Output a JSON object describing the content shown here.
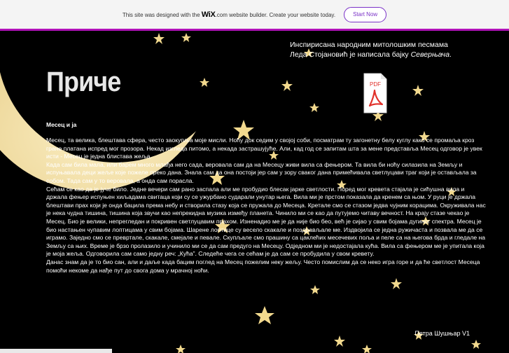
{
  "wix_banner": {
    "text_before": "This site was designed with the",
    "logo": "WiX",
    "text_after": ".com website builder. Create your website today.",
    "button_label": "Start Now"
  },
  "page": {
    "title": "Приче",
    "intro_line1": "Инспирисана народним митолошким песмама",
    "intro_line2_plain": "Леда Стојановић је написала бајку ",
    "intro_line2_italic": "Северњача",
    "intro_line2_end": ".",
    "pdf_label": "PDF",
    "story_title": "Месец и ја",
    "paragraphs": [
      "Месец, та велика, блештава сфера, често заокупља моје мисли. Ноћу док седим у својој соби, посматрам ту загонетну белу куглу како се промаља кроз гране платана испред мог прозора. Некад изгледа питомо, а некада застрашујуће. Али, кад год се запитам шта за мене представља Месец одговор је увек исти - Месец је једна блистава жеља.",
      "Када сам била мала, или барем много млађа него сада, веровала сам да на Месецу живи вила са фењером. Та вила би ноћу силазила на Земљу и испуњавала деци жеље које пожеле преко дана. Знала сам да она постоји јер сам у зору сваког дана примећивала светлуцави траг који је остављала за собом. Тада сам у то веровала, а онда сам порасла.",
      "Сећам се као да је јуче било. Једне вечери сам рано заспала али ме пробудио блесак јарке светлости. Поред мог кревета стајала је сићушна вила и држала фењер испуњен хиљадама свитаца који су се ужурбано сударали унутар њега. Вила ми је прстом показала да кренем са њом. У руци је држала блештави прах који је онда бацила према небу и створила стазу која се пружала до Месеца. Кретале смо се стазом једва чујним корацима. Окруживала нас је нека чудна тишина, тишина која звучи као непрекидна музика између планета. Чинило ми се као да путујемо читаву вечност. На крају стазе чекао је Месец. Био је велики, непрегледан и покривен светлуцавим прахом. Изненадио ме је да није био бео, већ је сијао у свим бојама дугиног спектра. Месец је био настањен чупавим лоптицама у свим бојама. Шарене лоптице су весело скакале и поздрављале ме. Издвојила се једна ружичаста и позвала ме да се играмо. Заједно смо се превртале, скакале, смејале и певале. Скупљале смо прашину са цаклећих месечевих поља и пеле са на његова брда и гледале на Земљу са њих. Време је брзо пролазило и учинило ми се да сам предуго на Месецу. Одједном ми је недостајала кућа. Вила са фењером ме је упитала која је моја жеља. Одговорила сам само једну реч: „Кућа”. Следеће чега се сећам је да сам се пробудила у свом кревету.",
      "Данас знам да је то био сан, али и даље када бацим поглед на Месец пожелим неку жељу. Често помислим да се неко игра горе и да ће светлост Месеца помоћи некоме да нађе пут до свога дома у мрачној ноћи."
    ],
    "author": "Петра Шушњар V1"
  },
  "colors": {
    "background": "#000000",
    "banner_accent": "#b012b8",
    "button_accent": "#7a31c7",
    "moon": "#f3e3b0",
    "pdf_red": "#e1312b"
  },
  "icons": [
    "pdf-icon",
    "moon-crescent",
    "star-icon"
  ]
}
